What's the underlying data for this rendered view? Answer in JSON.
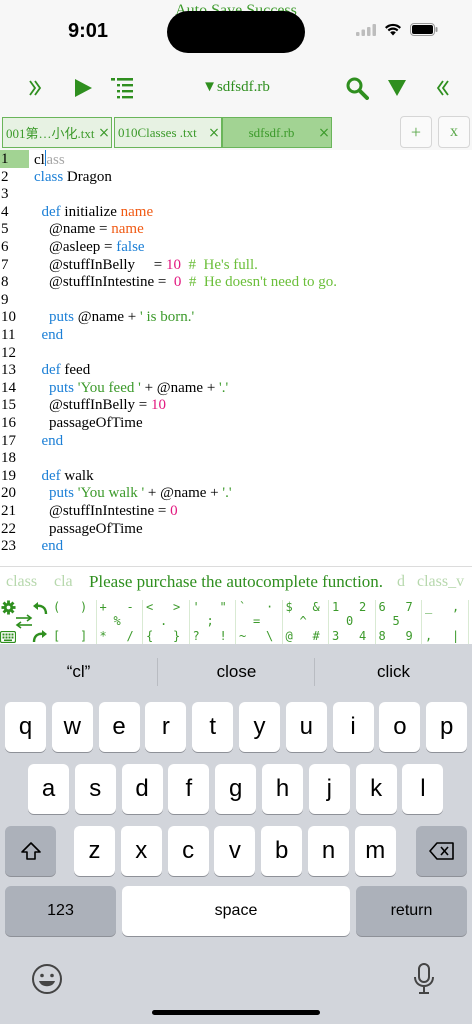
{
  "status_bar": {
    "banner": "Auto Save Success",
    "time": "9:01"
  },
  "toolbar": {
    "file_title": "▼sdfsdf.rb",
    "accent_color": "#2f8f1f"
  },
  "tabs": [
    {
      "label": "001第…小化.txt",
      "active": false
    },
    {
      "label": "010Classes .txt",
      "active": false
    },
    {
      "label": "sdfsdf.rb",
      "active": true
    }
  ],
  "tab_actions": {
    "add_label": "+",
    "close_label": "x"
  },
  "editor": {
    "lines": [
      {
        "n": "1",
        "tokens": [
          {
            "t": "cl",
            "c": ""
          },
          {
            "t": "|",
            "c": "cursor"
          },
          {
            "t": "ass",
            "c": "faded"
          }
        ]
      },
      {
        "n": "2",
        "tokens": [
          {
            "t": "class",
            "c": "kw"
          },
          {
            "t": " Dragon",
            "c": ""
          }
        ]
      },
      {
        "n": "3",
        "tokens": []
      },
      {
        "n": "4",
        "tokens": [
          {
            "t": "  ",
            "c": ""
          },
          {
            "t": "def",
            "c": "kw"
          },
          {
            "t": " initialize ",
            "c": ""
          },
          {
            "t": "name",
            "c": "arg"
          }
        ]
      },
      {
        "n": "5",
        "tokens": [
          {
            "t": "    @name = ",
            "c": ""
          },
          {
            "t": "name",
            "c": "arg"
          }
        ]
      },
      {
        "n": "6",
        "tokens": [
          {
            "t": "    @asleep = ",
            "c": ""
          },
          {
            "t": "false",
            "c": "kw"
          }
        ]
      },
      {
        "n": "7",
        "tokens": [
          {
            "t": "    @stuffInBelly     = ",
            "c": ""
          },
          {
            "t": "10",
            "c": "num"
          },
          {
            "t": "  #  He's full.",
            "c": "cmt"
          }
        ]
      },
      {
        "n": "8",
        "tokens": [
          {
            "t": "    @stuffInIntestine =  ",
            "c": ""
          },
          {
            "t": "0",
            "c": "num"
          },
          {
            "t": "  #  He doesn't need to go.",
            "c": "cmt"
          }
        ]
      },
      {
        "n": "9",
        "tokens": []
      },
      {
        "n": "10",
        "tokens": [
          {
            "t": "    ",
            "c": ""
          },
          {
            "t": "puts",
            "c": "kw"
          },
          {
            "t": " @name + ",
            "c": ""
          },
          {
            "t": "' is born.'",
            "c": "str"
          }
        ]
      },
      {
        "n": "11",
        "tokens": [
          {
            "t": "  ",
            "c": ""
          },
          {
            "t": "end",
            "c": "kw"
          }
        ]
      },
      {
        "n": "12",
        "tokens": []
      },
      {
        "n": "13",
        "tokens": [
          {
            "t": "  ",
            "c": ""
          },
          {
            "t": "def",
            "c": "kw"
          },
          {
            "t": " feed",
            "c": ""
          }
        ]
      },
      {
        "n": "14",
        "tokens": [
          {
            "t": "    ",
            "c": ""
          },
          {
            "t": "puts",
            "c": "kw"
          },
          {
            "t": " ",
            "c": ""
          },
          {
            "t": "'You feed '",
            "c": "str"
          },
          {
            "t": " + @name + ",
            "c": ""
          },
          {
            "t": "'.'",
            "c": "str"
          }
        ]
      },
      {
        "n": "15",
        "tokens": [
          {
            "t": "    @stuffInBelly = ",
            "c": ""
          },
          {
            "t": "10",
            "c": "num"
          }
        ]
      },
      {
        "n": "16",
        "tokens": [
          {
            "t": "    passageOfTime",
            "c": ""
          }
        ]
      },
      {
        "n": "17",
        "tokens": [
          {
            "t": "  ",
            "c": ""
          },
          {
            "t": "end",
            "c": "kw"
          }
        ]
      },
      {
        "n": "18",
        "tokens": []
      },
      {
        "n": "19",
        "tokens": [
          {
            "t": "  ",
            "c": ""
          },
          {
            "t": "def",
            "c": "kw"
          },
          {
            "t": " walk",
            "c": ""
          }
        ]
      },
      {
        "n": "20",
        "tokens": [
          {
            "t": "    ",
            "c": ""
          },
          {
            "t": "puts",
            "c": "kw"
          },
          {
            "t": " ",
            "c": ""
          },
          {
            "t": "'You walk '",
            "c": "str"
          },
          {
            "t": " + @name + ",
            "c": ""
          },
          {
            "t": "'.'",
            "c": "str"
          }
        ]
      },
      {
        "n": "21",
        "tokens": [
          {
            "t": "    @stuffInIntestine = ",
            "c": ""
          },
          {
            "t": "0",
            "c": "num"
          }
        ]
      },
      {
        "n": "22",
        "tokens": [
          {
            "t": "    passageOfTime",
            "c": ""
          }
        ]
      },
      {
        "n": "23",
        "tokens": [
          {
            "t": "  ",
            "c": ""
          },
          {
            "t": "end",
            "c": "kw"
          }
        ]
      }
    ],
    "current_line": "1"
  },
  "autocomplete": {
    "items": [
      "class",
      "cla",
      "d",
      "class_v"
    ],
    "message": "Please purchase the autocomplete function."
  },
  "symbol_keys": [
    {
      "tl": "(",
      "tr": ")",
      "bl": "[",
      "br": "]"
    },
    {
      "tl": "+",
      "tr": "-",
      "bl": "*",
      "br": "/"
    },
    {
      "tl": "<",
      "tr": ">",
      "bl": "{",
      "br": "}"
    },
    {
      "tl": "'",
      "tr": "\"",
      "bl": "?",
      "br": "!"
    },
    {
      "tl": "`",
      "tr": "·",
      "bl": "~",
      "br": "\\"
    },
    {
      "tl": "$",
      "tr": "&",
      "bl": "@",
      "br": "#"
    },
    {
      "tl": "1",
      "tr": "2",
      "bl": "3",
      "br": "4"
    },
    {
      "tl": "6",
      "tr": "7",
      "bl": "8",
      "br": "9"
    },
    {
      "tl": "_",
      "tr": ",",
      "bl": ",",
      "br": "|"
    }
  ],
  "symbol_centers": [
    "",
    "%",
    ".",
    ";",
    "=",
    "^",
    "0",
    "5",
    ""
  ],
  "keyboard": {
    "suggestions": [
      "“cl”",
      "close",
      "click"
    ],
    "row1": [
      "q",
      "w",
      "e",
      "r",
      "t",
      "y",
      "u",
      "i",
      "o",
      "p"
    ],
    "row2": [
      "a",
      "s",
      "d",
      "f",
      "g",
      "h",
      "j",
      "k",
      "l"
    ],
    "row3": [
      "z",
      "x",
      "c",
      "v",
      "b",
      "n",
      "m"
    ],
    "numbers_label": "123",
    "space_label": "space",
    "return_label": "return"
  }
}
